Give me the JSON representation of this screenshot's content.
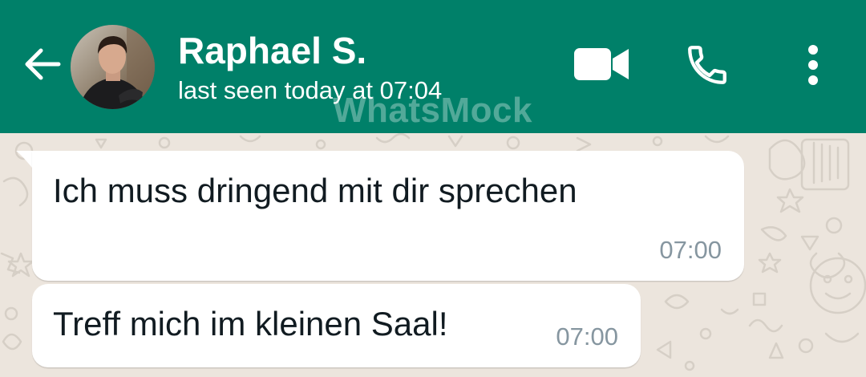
{
  "header": {
    "contact_name": "Raphael S.",
    "last_seen": "last seen today at 07:04",
    "watermark": "WhatsMock",
    "background_color": "#008069",
    "icons": {
      "back": "arrow-left-icon",
      "video": "video-camera-icon",
      "call": "phone-icon",
      "menu": "more-vertical-icon"
    }
  },
  "chat": {
    "background_color": "#ece5dd",
    "bubble_color": "#ffffff",
    "messages": [
      {
        "text": "Ich muss dringend mit dir sprechen",
        "time": "07:00"
      },
      {
        "text": "Treff mich im kleinen Saal!",
        "time": "07:00"
      }
    ]
  }
}
